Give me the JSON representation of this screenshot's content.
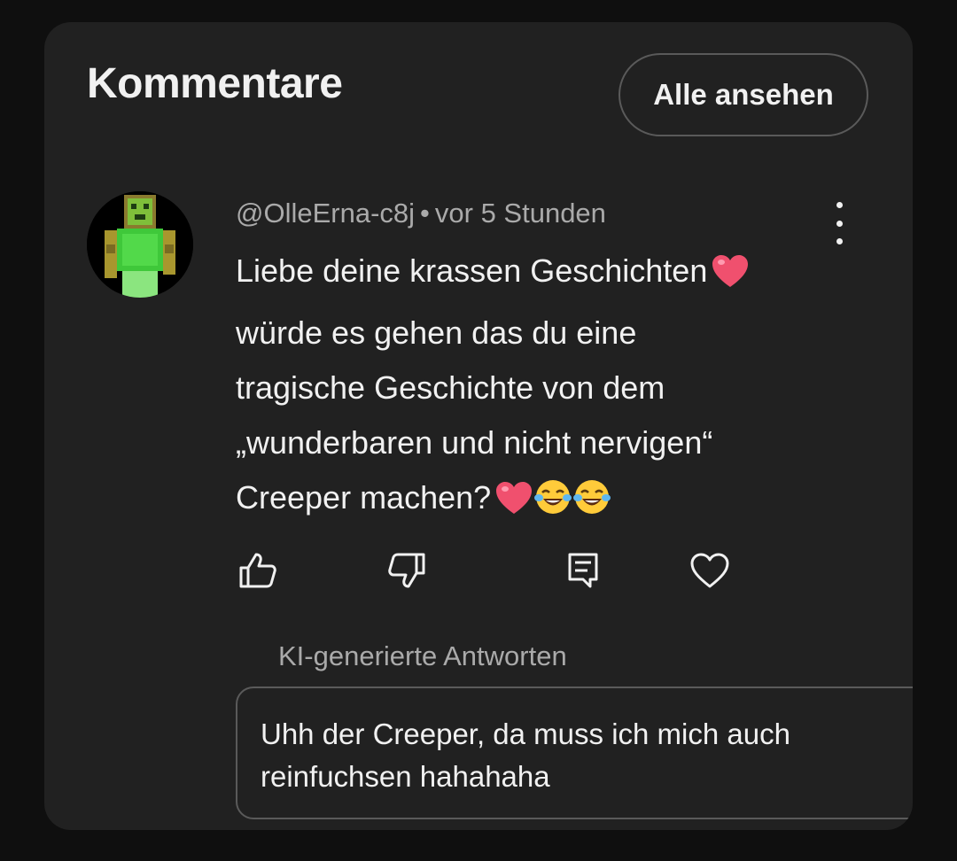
{
  "section": {
    "title": "Kommentare",
    "view_all_label": "Alle ansehen"
  },
  "comment": {
    "author": "@OlleErna-c8j",
    "separator": "•",
    "time": "vor 5 Stunden",
    "text_lines": [
      "Liebe deine krassen Geschichten",
      "würde es gehen das du eine",
      "tragische Geschichte von dem",
      "„wunderbaren und nicht nervigen“",
      "Creeper machen?"
    ],
    "emojis": [
      "heart-emoji",
      "heart-emoji",
      "tears-of-joy-emoji",
      "tears-of-joy-emoji"
    ],
    "actions": [
      "thumbs-up-icon",
      "thumbs-down-icon",
      "reply-icon",
      "heart-icon"
    ]
  },
  "ai_replies": {
    "label": "KI-generierte Antworten",
    "suggestion_lines": [
      "Uhh der Creeper, da muss ich mich auch",
      "reinfuchsen hahahaha"
    ]
  },
  "colors": {
    "background": "#0f0f0f",
    "panel": "#212121",
    "text_primary": "#f1f1f1",
    "text_secondary": "#aaaaaa",
    "border": "#5a5a5a",
    "emoji_heart": "#f0506e",
    "emoji_face": "#ffcb3a"
  }
}
